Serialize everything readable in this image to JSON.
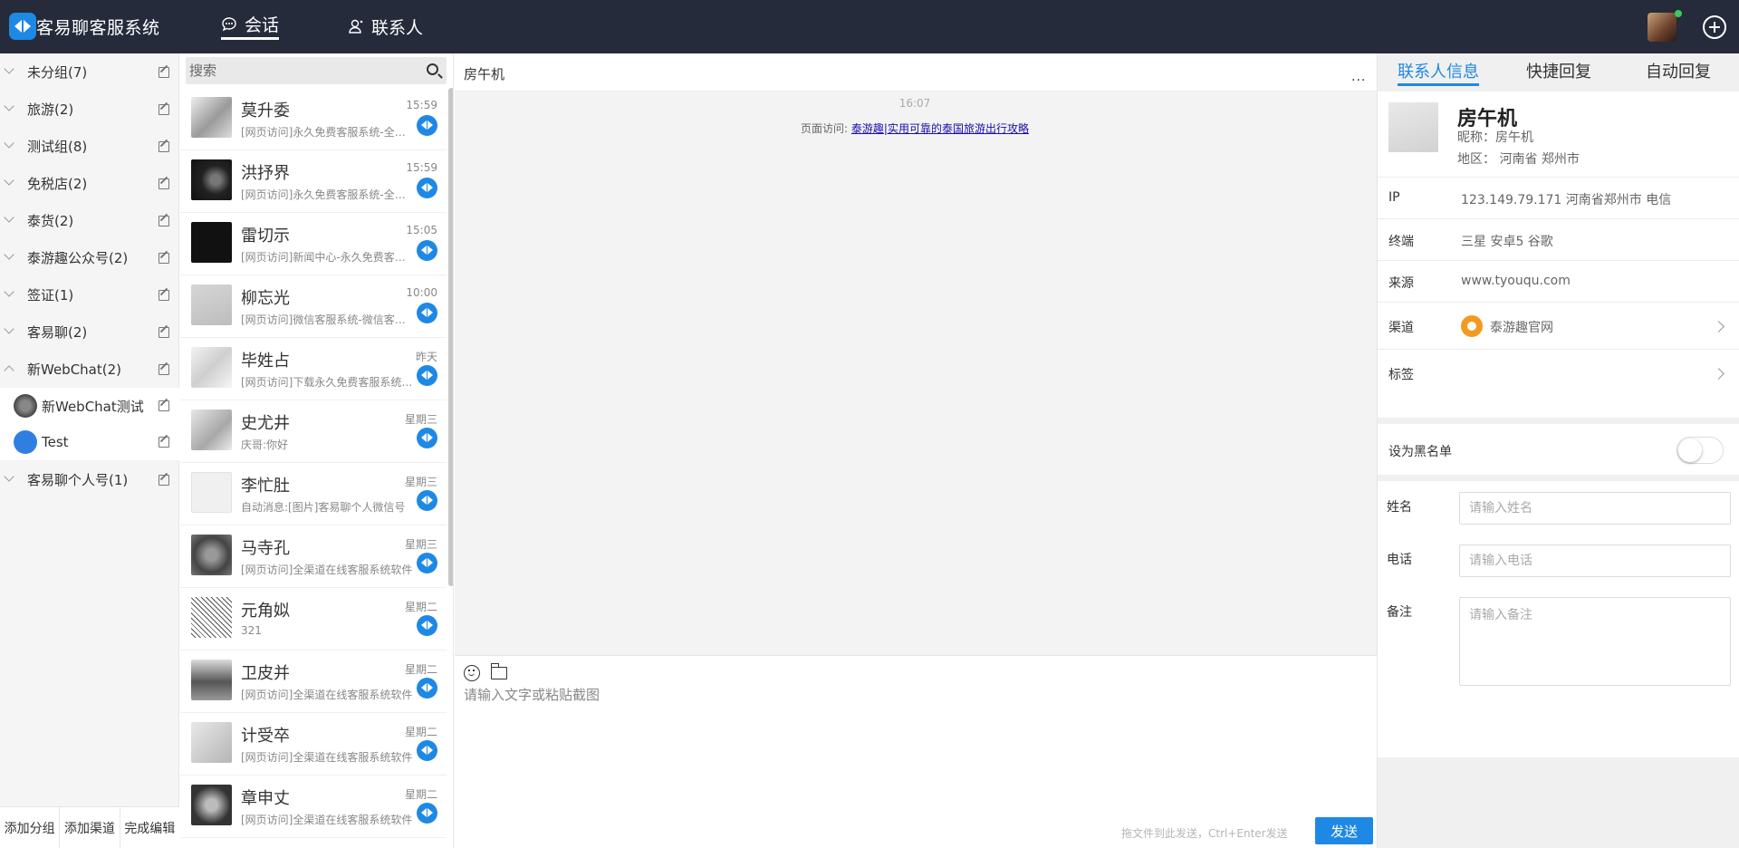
{
  "app": {
    "title": "客易聊客服系统"
  },
  "nav": {
    "sessions_label": "会话",
    "contacts_label": "联系人"
  },
  "groups": {
    "items": [
      {
        "label": "未分组(7)"
      },
      {
        "label": "旅游(2)"
      },
      {
        "label": "测试组(8)"
      },
      {
        "label": "免税店(2)"
      },
      {
        "label": "泰货(2)"
      },
      {
        "label": "泰游趣公众号(2)"
      },
      {
        "label": "签证(1)"
      },
      {
        "label": "客易聊(2)"
      },
      {
        "label": "新WebChat(2)"
      }
    ],
    "sub_items": [
      {
        "label": "新WebChat测试"
      },
      {
        "label": "Test"
      }
    ],
    "last_item": {
      "label": "客易聊个人号(1)"
    },
    "footer": {
      "add_group": "添加分组",
      "add_channel": "添加渠道",
      "finish_edit": "完成编辑"
    }
  },
  "search": {
    "placeholder": "搜索"
  },
  "conversations": [
    {
      "name": "莫升委",
      "time": "15:59",
      "message": "[网页访问]永久免费客服系统-全渠道在线客服系统"
    },
    {
      "name": "洪抒界",
      "time": "15:59",
      "message": "[网页访问]永久免费客服系统-全渠道在线客服系统"
    },
    {
      "name": "雷切示",
      "time": "15:05",
      "message": "[网页访问]新闻中心-永久免费客服系统"
    },
    {
      "name": "柳忘光",
      "time": "10:00",
      "message": "[网页访问]微信客服系统-微信客服软件"
    },
    {
      "name": "毕姓占",
      "time": "昨天",
      "message": "[网页访问]下载永久免费客服系统软件"
    },
    {
      "name": "史尤井",
      "time": "星期三",
      "message": "庆哥:你好"
    },
    {
      "name": "李忙肚",
      "time": "星期三",
      "message": "自动消息:[图片]客易聊个人微信号"
    },
    {
      "name": "马寺孔",
      "time": "星期三",
      "message": "[网页访问]全渠道在线客服系统软件"
    },
    {
      "name": "元角姒",
      "time": "星期二",
      "message": "321"
    },
    {
      "name": "卫皮并",
      "time": "星期二",
      "message": "[网页访问]全渠道在线客服系统软件"
    },
    {
      "name": "计受卒",
      "time": "星期二",
      "message": "[网页访问]全渠道在线客服系统软件"
    },
    {
      "name": "章申丈",
      "time": "星期二",
      "message": "[网页访问]全渠道在线客服系统软件"
    }
  ],
  "chat": {
    "title": "房午机",
    "more": "...",
    "message_time": "16:07",
    "visit_prefix": "页面访问:",
    "visit_link": "泰游趣|实用可靠的泰国旅游出行攻略",
    "input_placeholder": "请输入文字或粘贴截图",
    "send_hint": "拖文件到此发送，Ctrl+Enter发送",
    "send_label": "发送"
  },
  "right_panel": {
    "tabs": [
      "联系人信息",
      "快捷回复",
      "自动回复"
    ],
    "contact": {
      "name": "房午机",
      "nickname": "昵称：房午机",
      "region": "地区： 河南省 郑州市"
    },
    "info": [
      {
        "key": "IP",
        "value": "123.149.79.171 河南省郑州市 电信"
      },
      {
        "key": "终端",
        "value": "三星 安卓5 谷歌"
      },
      {
        "key": "来源",
        "value": "www.tyouqu.com"
      },
      {
        "key": "渠道",
        "value": "泰游趣官网"
      },
      {
        "key": "标签",
        "value": ""
      }
    ],
    "blacklist_label": "设为黑名单",
    "blacklist_enabled": false,
    "form": {
      "name_label": "姓名",
      "name_placeholder": "请输入姓名",
      "phone_label": "电话",
      "phone_placeholder": "请输入电话",
      "note_label": "备注",
      "note_placeholder": "请输入备注"
    }
  },
  "colors": {
    "header_bg": "#252b3b",
    "accent": "#1e88e5"
  }
}
